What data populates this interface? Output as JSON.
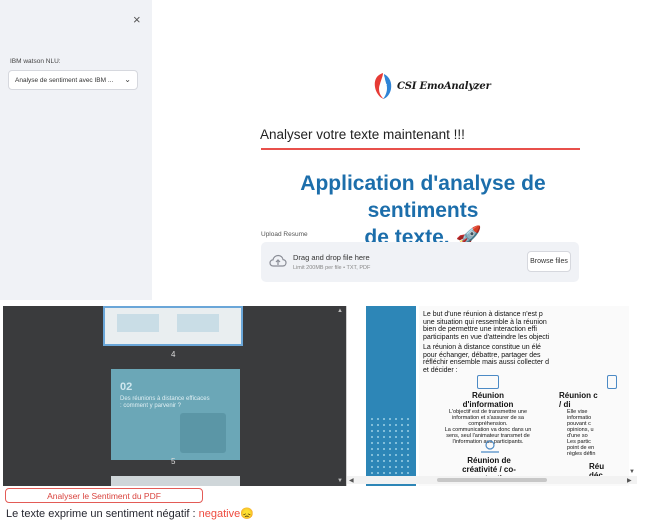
{
  "sidebar": {
    "close_symbol": "×",
    "label": "IBM watson NLU:",
    "select_value": "Analyse de sentiment avec IBM ...",
    "chevron": "⌄"
  },
  "header": {
    "logo_text": "CSI EmoAnalyzer"
  },
  "main": {
    "subheading": "Analyser votre texte maintenant !!!",
    "title_line1": "Application d'analyse de sentiments",
    "title_line2": "de texte.",
    "title_emoji": "🚀",
    "upload": {
      "label": "Upload Resume",
      "drop_text": "Drag and drop file here",
      "limit_text": "Limit 200MB per file • TXT, PDF",
      "browse_label": "Browse files"
    }
  },
  "pdf_viewer": {
    "thumb_page_a": "4",
    "thumb_page_b": "5",
    "thumb2_number": "02",
    "thumb2_title": "Des réunions à distance efficaces : comment y parvenir ?",
    "page_para1": "Le but d'une réunion à distance n'est p\nune situation qui ressemble à la réunion\nbien de permettre une interaction effi\nparticipants en vue d'atteindre les objecti",
    "page_para2": "La réunion à distance constitue un élé\npour échanger, débattre, partager des\nréfléchir ensemble mais aussi collecter d\net décider :",
    "section1_title": "Réunion\nd'information",
    "section1_text": "L'objectif est de transmettre une\ninformation et s'assurer de sa\ncompréhension.\nLa communication va donc dans un\nsens, seul l'animateur transmet de\nl'information aux participants.",
    "section2_title": "Réunion c\n/ di",
    "section2_text": "Elle vise\ninformatio\npouvant c\nopinions, u\nd'une so\nLes partic\npoint de en\nrègles défin",
    "section3_title": "Réunion de\ncréativité / co-\nconstuction",
    "section4_title": "Réu\ndéc"
  },
  "actions": {
    "analyze_pdf_label": "Analyser le Sentiment du PDF"
  },
  "result": {
    "prefix": "Le texte exprime un sentiment négatif : ",
    "sentiment": "negative",
    "emoji": "😞"
  },
  "colors": {
    "accent_red": "#e8504b",
    "title_blue": "#1c6eab",
    "sidebar_bg": "#f0f2f6"
  }
}
